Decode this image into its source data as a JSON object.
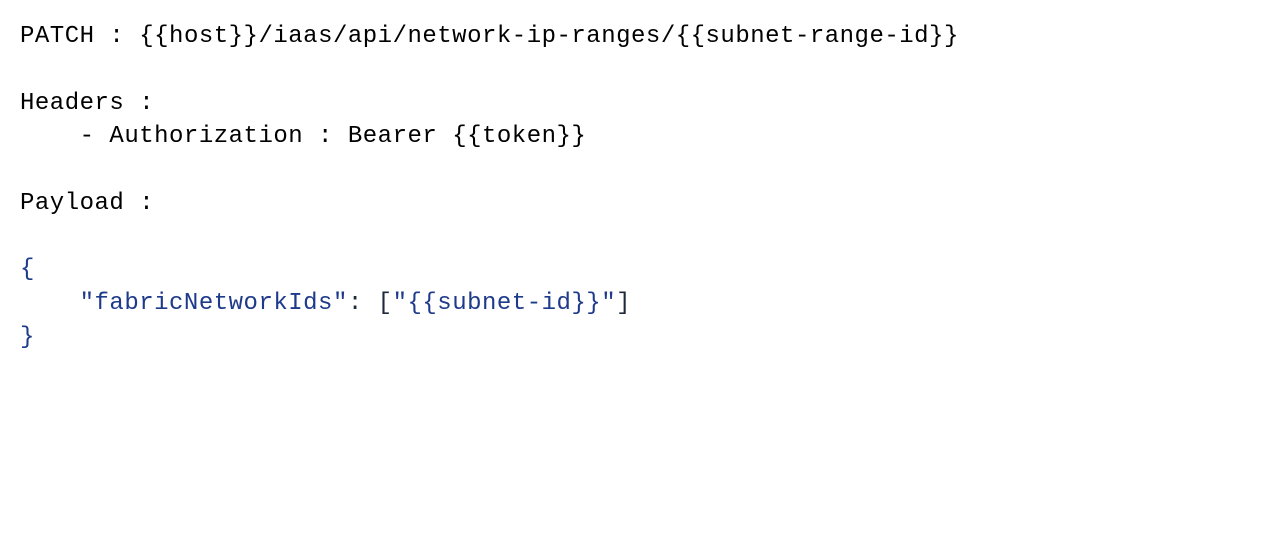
{
  "request": {
    "method_label": "PATCH",
    "method_sep": " : ",
    "url": "{{host}}/iaas/api/network-ip-ranges/{{subnet-range-id}}"
  },
  "headers_section": {
    "label": "Headers :",
    "items": [
      {
        "bullet": "    - ",
        "name": "Authorization",
        "sep": " : ",
        "value": "Bearer {{token}}"
      }
    ]
  },
  "payload_section": {
    "label": "Payload :"
  },
  "payload_json": {
    "open": "{",
    "indent": "    ",
    "key_quoted": "\"fabricNetworkIds\"",
    "colon_sep": ": ",
    "array_open": "[",
    "val_quoted": "\"{{subnet-id}}\"",
    "array_close": "]",
    "close": "}"
  }
}
